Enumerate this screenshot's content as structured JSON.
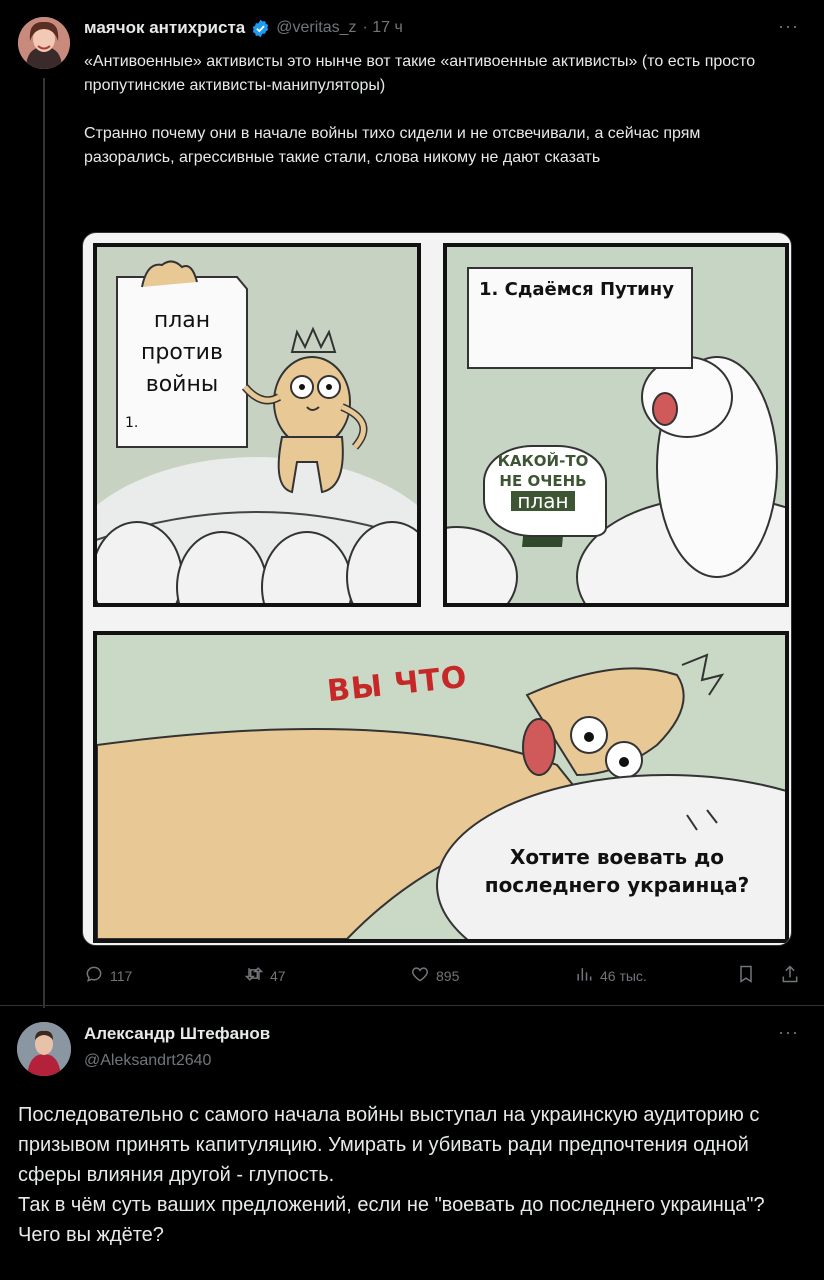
{
  "tweet": {
    "author_name": "маячок антихриста",
    "handle": "@veritas_z",
    "time": "· 17 ч",
    "more": "···",
    "text": "«Антивоенные» активисты это нынче вот такие «антивоенные активисты» (то есть просто пропутинские активисты-манипуляторы)\n\nСтранно почему они в начале войны тихо сидели и не отсвечивали, а сейчас прям разорались, агрессивные такие стали, слова никому не дают сказать",
    "comic": {
      "plan_line1": "план",
      "plan_line2": "против",
      "plan_line3": "войны",
      "plan_item": "1.",
      "caption_panel2": "1. Сдаёмся Путину",
      "speech_panel2_line1": "КАКОЙ-ТО",
      "speech_panel2_line2": "НЕ ОЧЕНЬ",
      "speech_panel2_line3": "план",
      "shout_panel3": "ВЫ ЧТО",
      "caption_panel3_line1": "Хотите воевать до",
      "caption_panel3_line2": "последнего украинца?"
    },
    "actions": {
      "replies": "117",
      "retweets": "47",
      "likes": "895",
      "views": "46 тыс."
    }
  },
  "reply": {
    "author_name": "Александр Штефанов",
    "handle": "@Aleksandrt2640",
    "more": "···",
    "text": "Последовательно с самого начала войны выступал на украинскую аудиторию с призывом принять капитуляцию. Умирать и убивать ради предпочтения одной сферы влияния другой - глупость.\nТак в чём суть ваших предложений, если не \"воевать до последнего украинца\"? Чего вы ждёте?"
  },
  "colors": {
    "background": "#000000",
    "text": "#e7e9ea",
    "secondary": "#71767b",
    "verified": "#1d9bf0"
  }
}
